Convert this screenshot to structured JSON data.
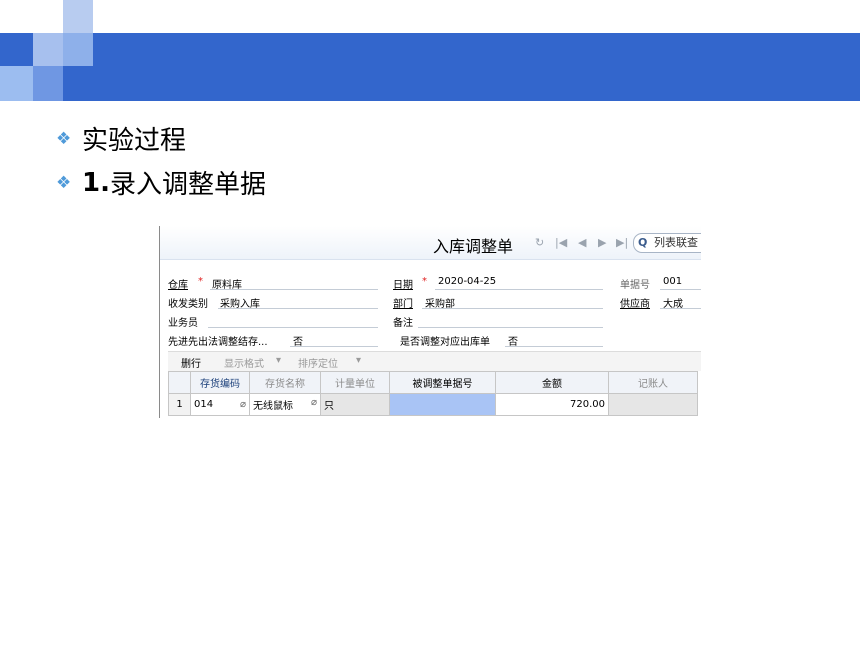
{
  "slide": {
    "bullets": [
      {
        "text": "实验过程"
      },
      {
        "num": "1.",
        "text": "录入调整单据"
      }
    ]
  },
  "form": {
    "title": "入库调整单",
    "search_label": "列表联查",
    "fields": {
      "warehouse_label": "仓库",
      "warehouse_value": "原料库",
      "date_label": "日期",
      "date_value": "2020-04-25",
      "doc_no_label": "单据号",
      "doc_no_value": "001",
      "receive_type_label": "收发类别",
      "receive_type_value": "采购入库",
      "dept_label": "部门",
      "dept_value": "采购部",
      "supplier_label": "供应商",
      "supplier_value": "大成",
      "salesman_label": "业务员",
      "remark_label": "备注",
      "fifo_label": "先进先出法调整结存...",
      "fifo_value": "否",
      "adjust_out_label": "是否调整对应出库单",
      "adjust_out_value": "否",
      "required_mark": "*"
    },
    "grid_toolbar": {
      "delete_row": "删行",
      "display_format": "显示格式",
      "sort_locate": "排序定位",
      "dropdown_arrow": "▾"
    },
    "grid": {
      "columns": [
        "存货编码",
        "存货名称",
        "计量单位",
        "被调整单据号",
        "金额",
        "记账人"
      ],
      "rows": [
        {
          "no": "1",
          "code": "014",
          "name": "无线鼠标",
          "unit": "只",
          "adjusted_doc": "",
          "amount": "720.00",
          "bookkeeper": ""
        }
      ]
    },
    "icons": {
      "refresh": "refresh-icon",
      "first": "first-page-icon",
      "prev": "prev-page-icon",
      "next": "next-page-icon",
      "last": "last-page-icon",
      "search": "search-icon",
      "attach": "paperclip-icon",
      "bullet": "diamond-bullet-icon"
    },
    "colors": {
      "header_band": "#3366cc",
      "selected_cell": "#a9c4f5",
      "required": "#e02020"
    }
  }
}
